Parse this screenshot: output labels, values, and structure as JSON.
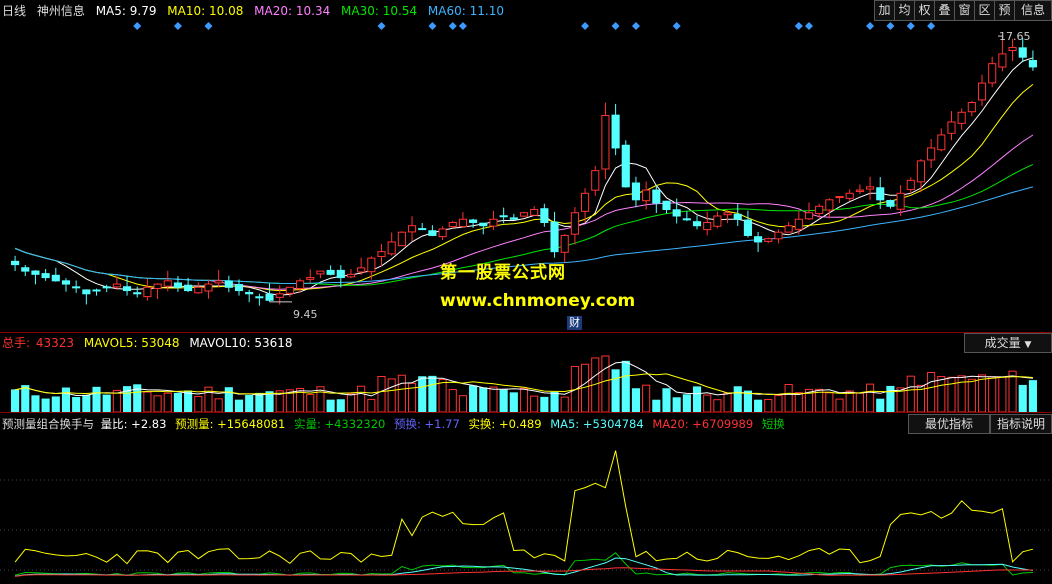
{
  "header": {
    "period": "日线",
    "stock": "神州信息",
    "ma5": "MA5: 9.79",
    "ma10": "MA10: 10.08",
    "ma20": "MA20: 10.34",
    "ma30": "MA30: 10.54",
    "ma60": "MA60: 11.10"
  },
  "toolbar": [
    "加",
    "均",
    "权",
    "叠",
    "窗",
    "区",
    "预",
    "信息"
  ],
  "price_panel": {
    "high_label": "17.65",
    "low_label": "9.45",
    "event_marker": "财"
  },
  "watermark": {
    "line1": "第一股票公式网",
    "line2": "www.chnmoney.com"
  },
  "volume_panel": {
    "label": "总手:",
    "value": "43323",
    "mavol5": "MAVOL5: 53048",
    "mavol10": "MAVOL10: 53618",
    "selector": "成交量"
  },
  "indicator_panel": {
    "name": "预测量组合换手与",
    "ratio": "量比: +2.83",
    "forecast": "预测量: +15648081",
    "actual": "实量: +4332320",
    "forecast_turnover": "预换: +1.77",
    "actual_turnover": "实换: +0.489",
    "ma5": "MA5: +5304784",
    "ma20": "MA20: +6709989",
    "short": "短换",
    "btn_best": "最优指标",
    "btn_help": "指标说明"
  },
  "colors": {
    "up": "#ff3232",
    "down": "#54ffff",
    "ma5": "#ffffff",
    "ma10": "#ffff00",
    "ma20": "#ff80ff",
    "ma30": "#00e600",
    "ma60": "#3cb4ff"
  },
  "chart_data": {
    "type": "candlestick",
    "price_axis_marks": {
      "max": 17.65,
      "min": 9.45
    },
    "closes": [
      10.6,
      10.4,
      10.3,
      10.2,
      10.1,
      10.0,
      9.9,
      9.7,
      9.8,
      9.9,
      10.0,
      9.8,
      9.7,
      9.9,
      10.0,
      10.1,
      9.9,
      9.8,
      9.9,
      10.0,
      10.1,
      9.9,
      9.8,
      9.7,
      9.6,
      9.5,
      9.7,
      9.9,
      10.1,
      10.2,
      10.4,
      10.3,
      10.2,
      10.3,
      10.5,
      10.8,
      11.0,
      11.3,
      11.6,
      11.8,
      11.7,
      11.5,
      11.7,
      11.9,
      12.0,
      11.9,
      11.8,
      12.0,
      12.1,
      12.0,
      12.2,
      12.3,
      11.9,
      11.0,
      11.5,
      12.2,
      12.8,
      13.5,
      15.2,
      14.2,
      13.0,
      12.6,
      12.9,
      12.5,
      12.3,
      12.1,
      12.0,
      11.8,
      11.9,
      12.1,
      12.2,
      12.0,
      11.5,
      11.3,
      11.4,
      11.6,
      11.8,
      12.0,
      12.2,
      12.4,
      12.6,
      12.7,
      12.8,
      12.9,
      13.0,
      12.6,
      12.4,
      12.8,
      13.2,
      13.8,
      14.2,
      14.6,
      15.0,
      15.3,
      15.6,
      16.2,
      16.8,
      17.1,
      17.3,
      17.0,
      16.7
    ]
  }
}
